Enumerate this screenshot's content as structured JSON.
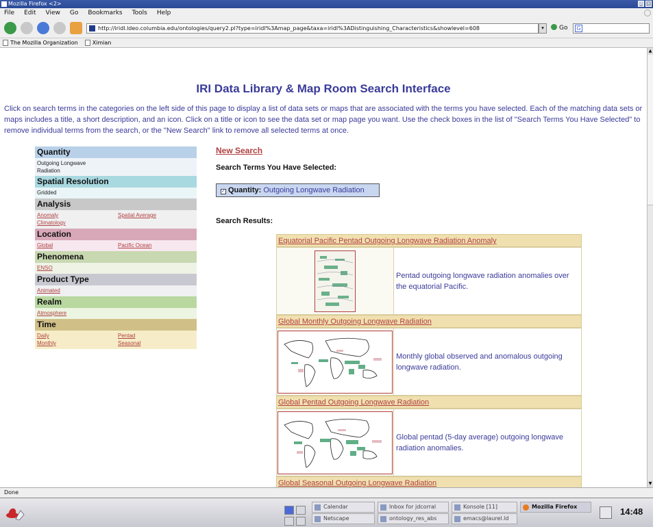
{
  "window": {
    "title": "Mozilla Firefox <2>"
  },
  "menubar": {
    "items": [
      "File",
      "Edit",
      "View",
      "Go",
      "Bookmarks",
      "Tools",
      "Help"
    ]
  },
  "navbar": {
    "url": "http://iridl.ldeo.columbia.edu/ontologies/query2.pl?type=iridl%3Amap_page&taxa=iridl%3ADistinguishing_Characteristics&showlevel=608",
    "go_label": "Go"
  },
  "bookmarks": [
    "The Mozilla Organization",
    "Ximian"
  ],
  "page": {
    "title": "IRI Data Library & Map Room Search Interface",
    "intro": "Click on search terms in the categories on the left side of this page to display a list of data sets or maps that are associated with the terms you have selected. Each of the matching data sets or maps includes a title, a short description, and an icon. Click on a title or icon to see the data set or map page you want. Use the check boxes in the list of \"Search Terms You Have Selected\" to remove individual terms from the search, or the \"New Search\" link to remove all selected terms at once."
  },
  "facets": [
    {
      "name": "Quantity",
      "color": "#b8d0e8",
      "body_color": "#eef3f8",
      "selected": "Outgoing Longwave Radiation",
      "terms": []
    },
    {
      "name": "Spatial Resolution",
      "color": "#a8d8e0",
      "body_color": "#eaf5f7",
      "selected": "Gridded",
      "terms": []
    },
    {
      "name": "Analysis",
      "color": "#c8c8c8",
      "body_color": "#f0f0f0",
      "selected": "",
      "terms": [
        "Anomaly",
        "Spatial Average",
        "Climatology"
      ]
    },
    {
      "name": "Location",
      "color": "#d8a8b8",
      "body_color": "#f6e8ee",
      "selected": "",
      "terms": [
        "Global",
        "Pacific Ocean"
      ]
    },
    {
      "name": "Phenomena",
      "color": "#c8d8b0",
      "body_color": "#eef3e6",
      "selected": "",
      "terms": [
        "ENSO"
      ]
    },
    {
      "name": "Product Type",
      "color": "#c8c8d0",
      "body_color": "#f0f0f2",
      "selected": "",
      "terms": [
        "Animated"
      ]
    },
    {
      "name": "Realm",
      "color": "#b8d8a0",
      "body_color": "#ecf4e2",
      "selected": "",
      "terms": [
        "Atmosphere"
      ]
    },
    {
      "name": "Time",
      "color": "#d0c088",
      "body_color": "#f6edc8",
      "selected": "",
      "terms": [
        "Daily",
        "Pentad",
        "Monthly",
        "Seasonal"
      ]
    }
  ],
  "search": {
    "new_search": "New Search",
    "selected_header": "Search Terms You Have Selected:",
    "selected_term_category": "Quantity:",
    "selected_term_value": "Outgoing Longwave Radiation",
    "results_header": "Search Results:"
  },
  "results": [
    {
      "title": "Equatorial Pacific Pentad Outgoing Longwave Radiation Anomaly",
      "desc": "Pentad outgoing longwave radiation anomalies over the equatorial Pacific.",
      "icon": "equatorial-pacific-map"
    },
    {
      "title": "Global Monthly Outgoing Longwave Radiation",
      "desc": "Monthly global observed and anomalous outgoing longwave radiation.",
      "icon": "global-map"
    },
    {
      "title": "Global Pentad Outgoing Longwave Radiation",
      "desc": "Global pentad (5-day average) outgoing longwave radiation anomalies.",
      "icon": "global-map"
    },
    {
      "title": "Global Seasonal Outgoing Longwave Radiation",
      "desc": "",
      "icon": "global-map"
    }
  ],
  "status": "Done",
  "taskbar": {
    "tasks": [
      "Calendar",
      "Netscape",
      "Inbox for jdcorral",
      "ontology_res_abs",
      "Konsole [11]",
      "emacs@laurel.ld",
      "Mozilla Firefox"
    ],
    "clock": "14:48"
  }
}
